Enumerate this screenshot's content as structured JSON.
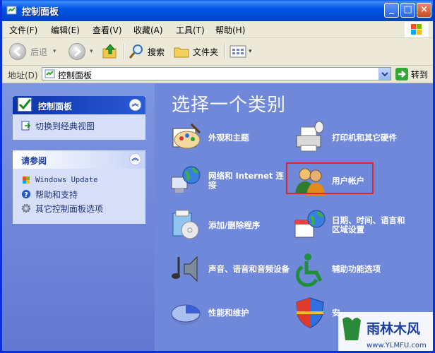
{
  "window": {
    "title": "控制面板"
  },
  "menu": [
    "文件(F)",
    "编辑(E)",
    "查看(V)",
    "收藏(A)",
    "工具(T)",
    "帮助(H)"
  ],
  "toolbar": {
    "back": "后退",
    "search": "搜索",
    "folders": "文件夹"
  },
  "address": {
    "label": "地址(D)",
    "value": "控制面板",
    "go": "转到"
  },
  "sidebar": {
    "control_panel": {
      "title": "控制面板",
      "switch_view": "切换到经典视图"
    },
    "see_also": {
      "title": "请参阅",
      "items": [
        "Windows Update",
        "帮助和支持",
        "其它控制面板选项"
      ]
    }
  },
  "content": {
    "heading": "选择一个类别",
    "categories": [
      {
        "label": "外观和主题",
        "icon": "appearance-icon"
      },
      {
        "label": "打印机和其它硬件",
        "icon": "printer-icon"
      },
      {
        "label": "网络和 Internet 连接",
        "icon": "network-icon"
      },
      {
        "label": "用户帐户",
        "icon": "users-icon",
        "highlighted": true
      },
      {
        "label": "添加/删除程序",
        "icon": "programs-icon"
      },
      {
        "label": "日期、时间、语言和区域设置",
        "icon": "datetime-icon"
      },
      {
        "label": "声音、语音和音频设备",
        "icon": "sound-icon"
      },
      {
        "label": "辅助功能选项",
        "icon": "accessibility-icon"
      },
      {
        "label": "性能和维护",
        "icon": "performance-icon"
      },
      {
        "label": "安",
        "icon": "security-icon"
      }
    ]
  },
  "watermark": {
    "text": "雨林木风",
    "url": "www.YLMFU.com"
  },
  "colors": {
    "titlebar": "#0055e5",
    "content_bg": "#6f88da",
    "highlight": "#e0262a"
  }
}
